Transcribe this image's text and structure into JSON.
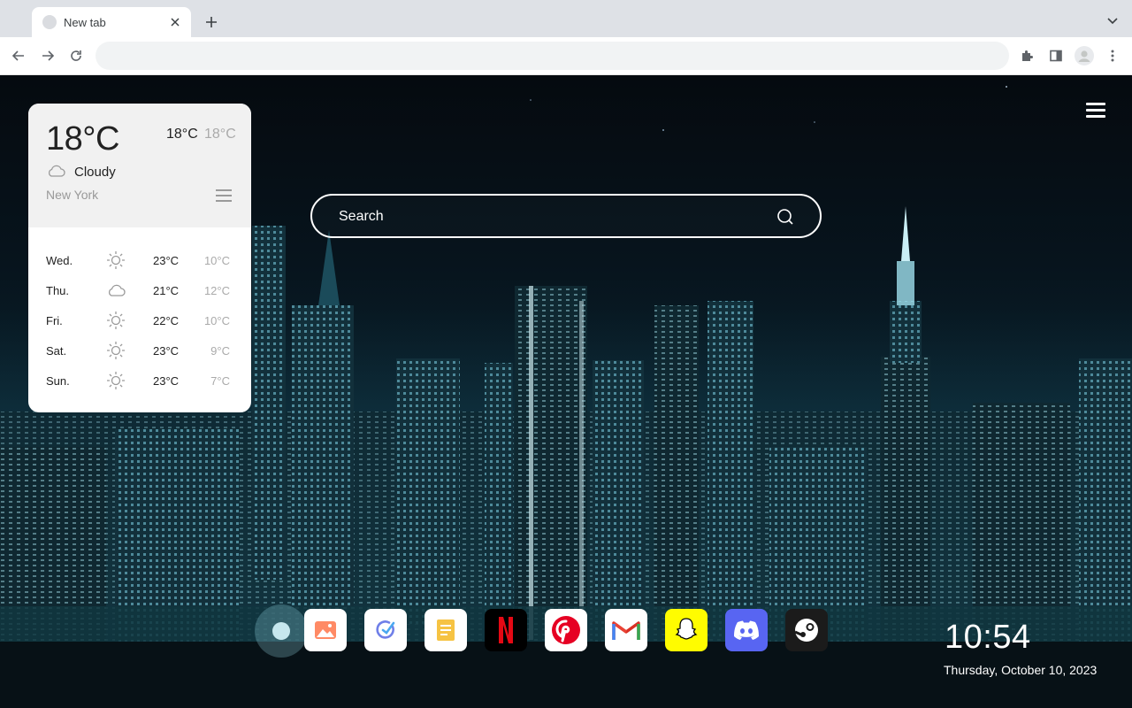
{
  "browser": {
    "tab_title": "New tab",
    "address_value": "",
    "icons": [
      "favicon",
      "close-icon",
      "plus-icon",
      "chevron-down-icon",
      "back-arrow-icon",
      "forward-arrow-icon",
      "reload-icon",
      "puzzle-icon",
      "side-panel-icon",
      "profile-icon",
      "more-vert-icon"
    ]
  },
  "weather": {
    "current_temp": "18°C",
    "high": "18°C",
    "low": "18°C",
    "condition": "Cloudy",
    "city": "New York",
    "forecast": [
      {
        "day": "Wed.",
        "icon": "sun-icon",
        "high": "23°C",
        "low": "10°C"
      },
      {
        "day": "Thu.",
        "icon": "cloud-icon",
        "high": "21°C",
        "low": "12°C"
      },
      {
        "day": "Fri.",
        "icon": "sun-icon",
        "high": "22°C",
        "low": "10°C"
      },
      {
        "day": "Sat.",
        "icon": "sun-icon",
        "high": "23°C",
        "low": "9°C"
      },
      {
        "day": "Sun.",
        "icon": "sun-icon",
        "high": "23°C",
        "low": "7°C"
      }
    ]
  },
  "search": {
    "placeholder": "Search"
  },
  "dock": [
    {
      "name": "photos",
      "bg": "#ffffff"
    },
    {
      "name": "tasks",
      "bg": "#ffffff"
    },
    {
      "name": "notes",
      "bg": "#ffffff"
    },
    {
      "name": "netflix",
      "bg": "#000000"
    },
    {
      "name": "pinterest",
      "bg": "#ffffff"
    },
    {
      "name": "gmail",
      "bg": "#ffffff"
    },
    {
      "name": "snapchat",
      "bg": "#fffc00"
    },
    {
      "name": "discord",
      "bg": "#5865f2"
    },
    {
      "name": "steam",
      "bg": "#1b1b1b"
    }
  ],
  "clock": {
    "time": "10:54",
    "date": "Thursday, October 10, 2023"
  }
}
